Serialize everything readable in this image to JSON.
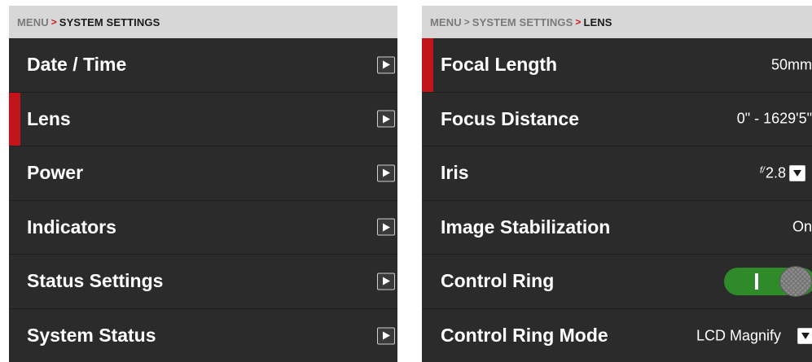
{
  "left_panel": {
    "breadcrumb": {
      "root": "MENU",
      "separator": ">",
      "current": "SYSTEM SETTINGS"
    },
    "items": [
      {
        "label": "Date / Time"
      },
      {
        "label": "Lens"
      },
      {
        "label": "Power"
      },
      {
        "label": "Indicators"
      },
      {
        "label": "Status Settings"
      },
      {
        "label": "System Status"
      }
    ],
    "selected_item": "Lens"
  },
  "right_panel": {
    "breadcrumb": {
      "root": "MENU",
      "separator": ">",
      "middle": "SYSTEM SETTINGS",
      "current": "LENS"
    },
    "items": [
      {
        "label": "Focal Length",
        "value": "50mm"
      },
      {
        "label": "Focus Distance",
        "value": "0\" - 1629'5\""
      },
      {
        "label": "Iris",
        "value_prefix": "f/",
        "value": "2.8"
      },
      {
        "label": "Image Stabilization",
        "value": "On"
      },
      {
        "label": "Control Ring",
        "toggle_state": "on"
      },
      {
        "label": "Control Ring Mode",
        "value": "LCD Magnify"
      }
    ],
    "selected_item": "Focal Length"
  },
  "colors": {
    "accent_red": "#c4141b",
    "toggle_green": "#2f8a2a",
    "panel_bg": "#2b2b2b",
    "breadcrumb_bg": "#d7d7d7"
  },
  "icons": {
    "submenu_arrow": "chevron-right-icon",
    "dropdown": "chevron-down-icon"
  }
}
